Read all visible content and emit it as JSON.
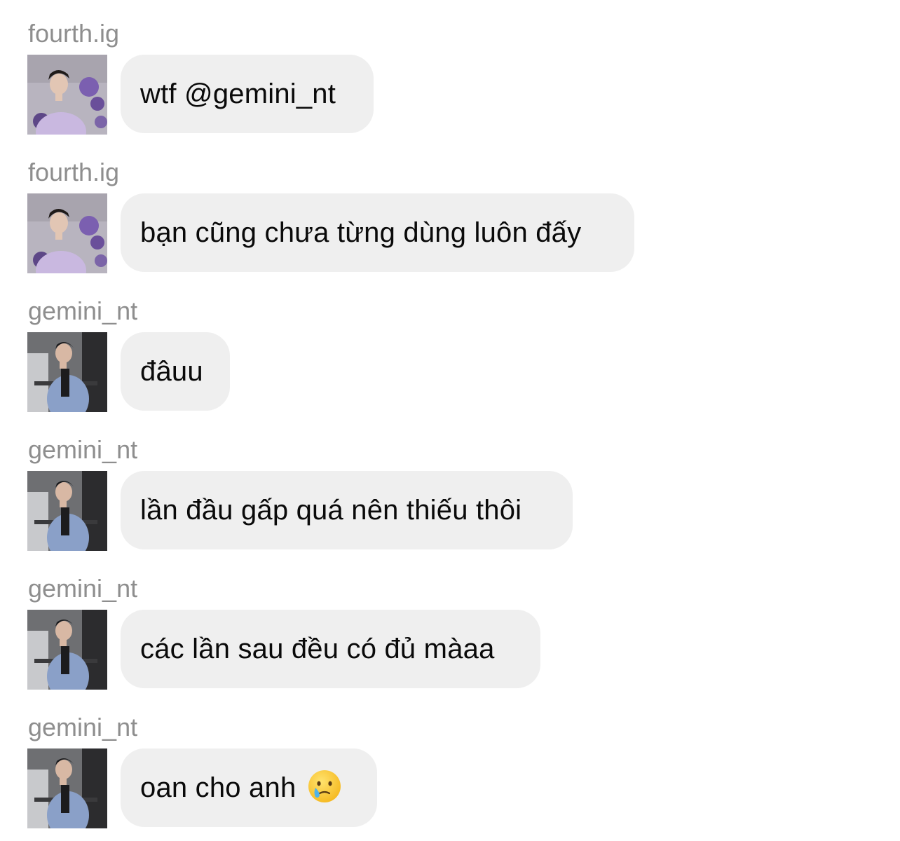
{
  "messages": [
    {
      "sender": "fourth.ig",
      "text": "wtf @gemini_nt",
      "avatar": "fourth-avatar"
    },
    {
      "sender": "fourth.ig",
      "text": "bạn cũng chưa từng dùng luôn đấy",
      "avatar": "fourth-avatar"
    },
    {
      "sender": "gemini_nt",
      "text": "đâuu",
      "avatar": "gemini-avatar"
    },
    {
      "sender": "gemini_nt",
      "text": "lần đầu gấp quá nên thiếu thôi",
      "avatar": "gemini-avatar"
    },
    {
      "sender": "gemini_nt",
      "text": "các lần sau đều có đủ màaa",
      "avatar": "gemini-avatar"
    },
    {
      "sender": "gemini_nt",
      "text": "oan cho anh",
      "emoji": "crying-face-emoji",
      "avatar": "gemini-avatar"
    }
  ],
  "colors": {
    "background": "#ffffff",
    "bubble": "#efefef",
    "sender_name": "#8e8e8e",
    "message_text": "#0a0a0a"
  }
}
